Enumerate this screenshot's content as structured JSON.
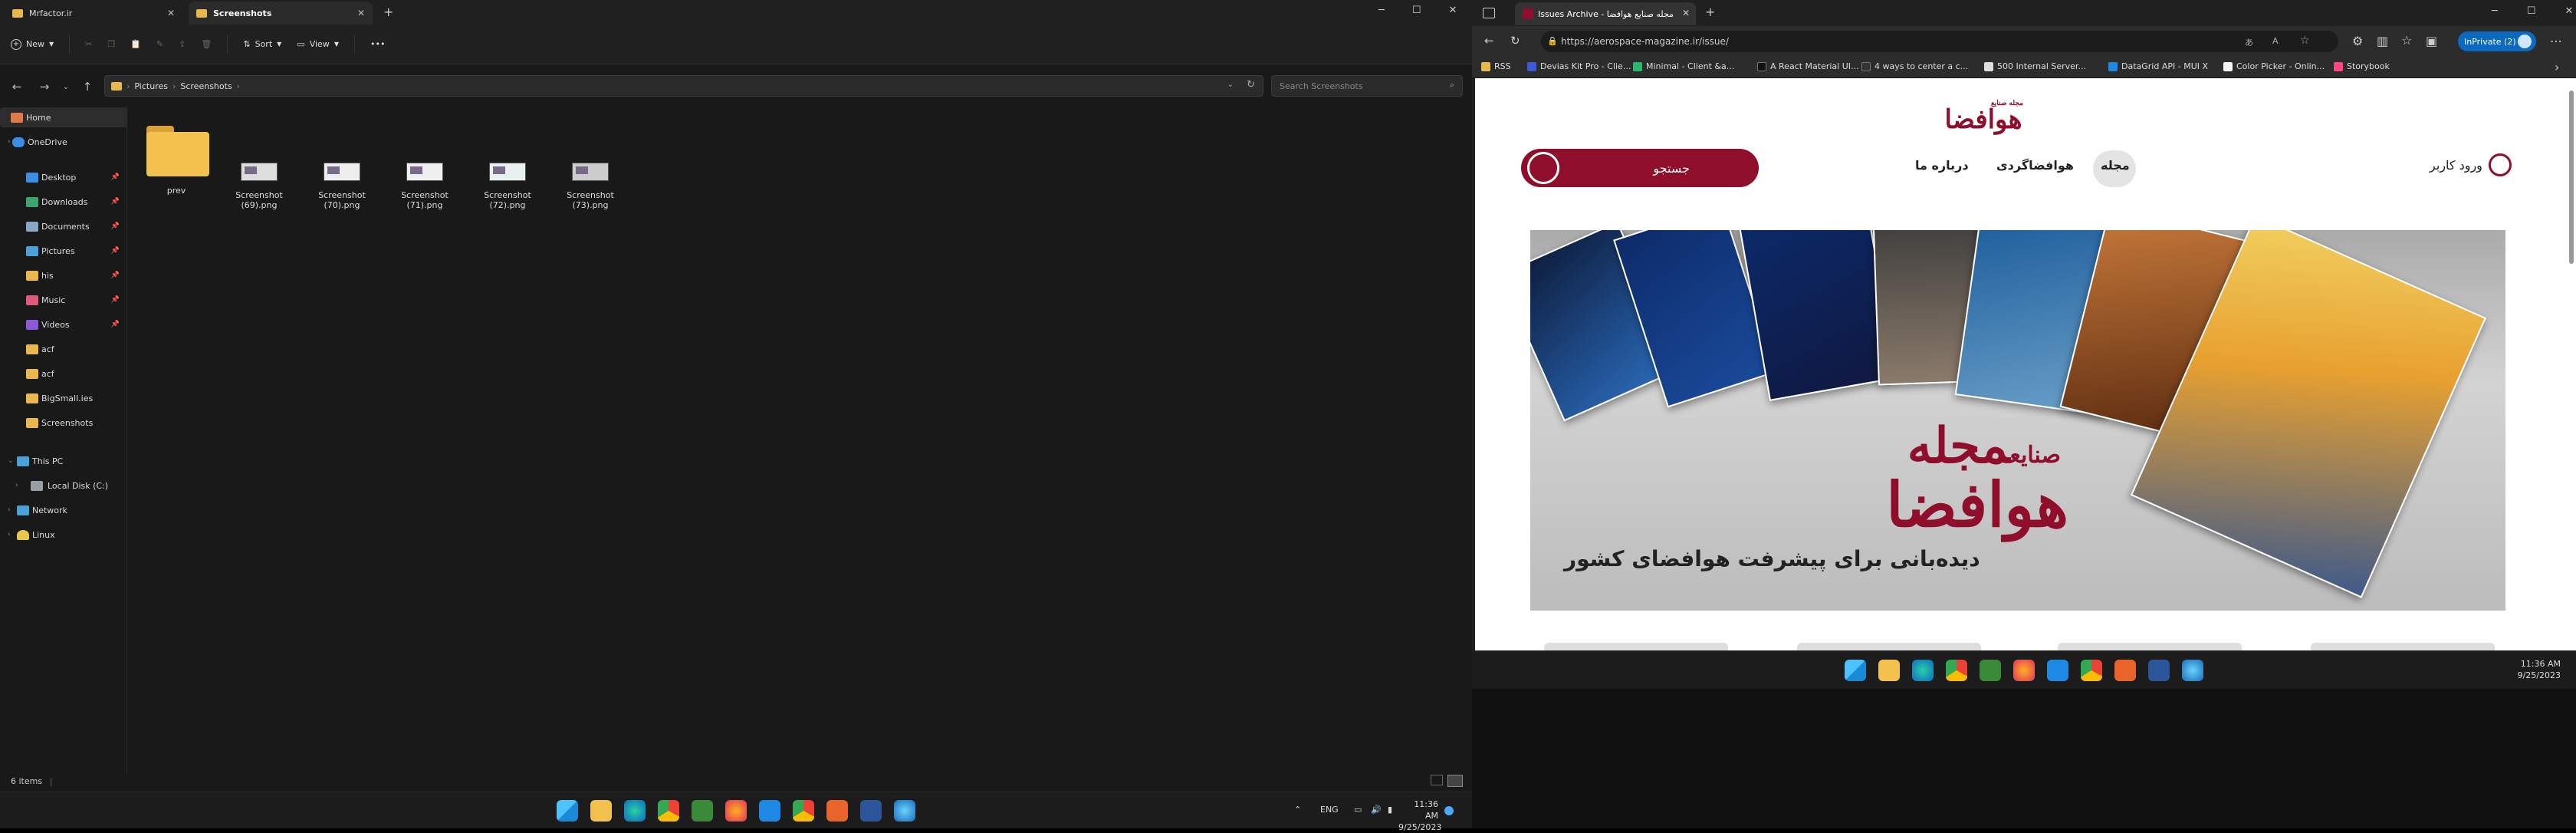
{
  "explorer": {
    "tabs": [
      {
        "label": "Mrfactor.ir"
      },
      {
        "label": "Screenshots"
      }
    ],
    "commands": {
      "new": "New",
      "sort": "Sort",
      "view": "View"
    },
    "breadcrumb": [
      "Pictures",
      "Screenshots"
    ],
    "search_placeholder": "Search Screenshots",
    "nav": {
      "home": "Home",
      "onedrive": "OneDrive",
      "desktop": "Desktop",
      "downloads": "Downloads",
      "documents": "Documents",
      "pictures": "Pictures",
      "his": "his",
      "music": "Music",
      "videos": "Videos",
      "acf1": "acf",
      "acf2": "acf",
      "bigsmall": "BigSmall.ies",
      "screenshots": "Screenshots",
      "thispc": "This PC",
      "localdisk": "Local Disk (C:)",
      "network": "Network",
      "linux": "Linux"
    },
    "files": [
      {
        "name": "prev"
      },
      {
        "name": "Screenshot (69).png"
      },
      {
        "name": "Screenshot (70).png"
      },
      {
        "name": "Screenshot (71).png"
      },
      {
        "name": "Screenshot (72).png"
      },
      {
        "name": "Screenshot (73).png"
      }
    ],
    "status": "6 items",
    "taskbar": {
      "lang": "ENG",
      "time": "11:36 AM",
      "date": "9/25/2023"
    }
  },
  "edge": {
    "tab_title": "Issues Archive - مجله صنایع هوافضا",
    "url": "https://aerospace-magazine.ir/issue/",
    "inprivate": "InPrivate (2)",
    "bookmarks": [
      "RSS",
      "Devias Kit Pro - Clie...",
      "Minimal - Client &a...",
      "A React Material UI...",
      "4 ways to center a c...",
      "500 Internal Server...",
      "DataGrid API - MUI X",
      "Color Picker - Onlin...",
      "Storybook"
    ],
    "taskbar": {
      "time": "11:36 AM",
      "date": "9/25/2023"
    }
  },
  "site": {
    "logo_small": "مجله صنایع",
    "logo": "هوافضا",
    "search": "جستجو",
    "nav": [
      "مجله",
      "هوافضاگردی",
      "درباره ما"
    ],
    "login": "ورود کاربر",
    "hero_title_1": "مجله",
    "hero_title_small": "صنایع",
    "hero_title_2": "هوافضا",
    "hero_sub": "دیده‌بانی برای پیشرفت هوافضای کشور"
  }
}
